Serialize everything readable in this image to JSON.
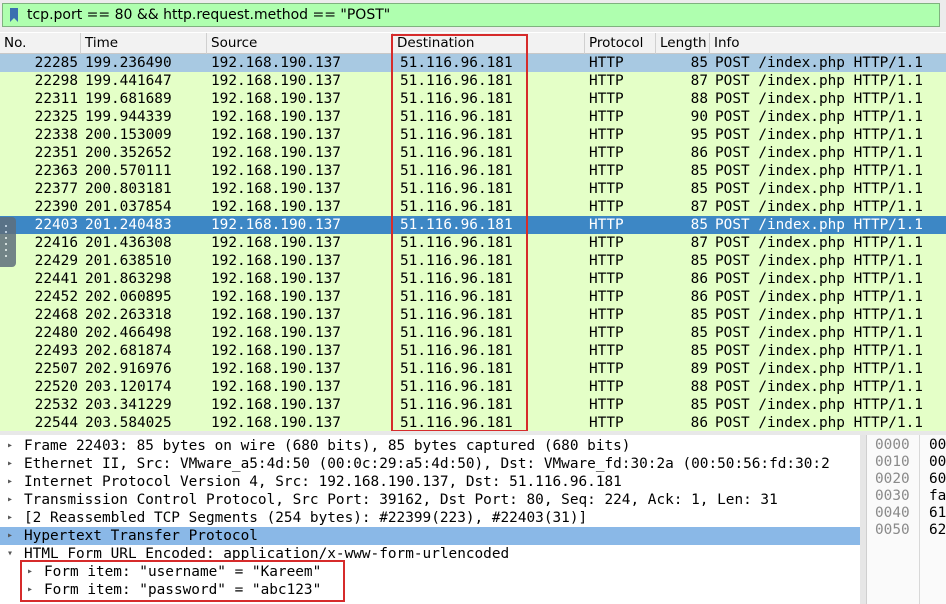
{
  "filter": {
    "text": "tcp.port == 80 && http.request.method == \"POST\""
  },
  "columns": [
    "No.",
    "Time",
    "Source",
    "Destination",
    "Protocol",
    "Length",
    "Info"
  ],
  "packets": [
    {
      "no": "22285",
      "time": "199.236490",
      "src": "192.168.190.137",
      "dst": "51.116.96.181",
      "proto": "HTTP",
      "len": "85",
      "info": "POST /index.php HTTP/1.1"
    },
    {
      "no": "22298",
      "time": "199.441647",
      "src": "192.168.190.137",
      "dst": "51.116.96.181",
      "proto": "HTTP",
      "len": "87",
      "info": "POST /index.php HTTP/1.1"
    },
    {
      "no": "22311",
      "time": "199.681689",
      "src": "192.168.190.137",
      "dst": "51.116.96.181",
      "proto": "HTTP",
      "len": "88",
      "info": "POST /index.php HTTP/1.1"
    },
    {
      "no": "22325",
      "time": "199.944339",
      "src": "192.168.190.137",
      "dst": "51.116.96.181",
      "proto": "HTTP",
      "len": "90",
      "info": "POST /index.php HTTP/1.1"
    },
    {
      "no": "22338",
      "time": "200.153009",
      "src": "192.168.190.137",
      "dst": "51.116.96.181",
      "proto": "HTTP",
      "len": "95",
      "info": "POST /index.php HTTP/1.1"
    },
    {
      "no": "22351",
      "time": "200.352652",
      "src": "192.168.190.137",
      "dst": "51.116.96.181",
      "proto": "HTTP",
      "len": "86",
      "info": "POST /index.php HTTP/1.1"
    },
    {
      "no": "22363",
      "time": "200.570111",
      "src": "192.168.190.137",
      "dst": "51.116.96.181",
      "proto": "HTTP",
      "len": "85",
      "info": "POST /index.php HTTP/1.1"
    },
    {
      "no": "22377",
      "time": "200.803181",
      "src": "192.168.190.137",
      "dst": "51.116.96.181",
      "proto": "HTTP",
      "len": "85",
      "info": "POST /index.php HTTP/1.1"
    },
    {
      "no": "22390",
      "time": "201.037854",
      "src": "192.168.190.137",
      "dst": "51.116.96.181",
      "proto": "HTTP",
      "len": "87",
      "info": "POST /index.php HTTP/1.1"
    },
    {
      "no": "22403",
      "time": "201.240483",
      "src": "192.168.190.137",
      "dst": "51.116.96.181",
      "proto": "HTTP",
      "len": "85",
      "info": "POST /index.php HTTP/1.1"
    },
    {
      "no": "22416",
      "time": "201.436308",
      "src": "192.168.190.137",
      "dst": "51.116.96.181",
      "proto": "HTTP",
      "len": "87",
      "info": "POST /index.php HTTP/1.1"
    },
    {
      "no": "22429",
      "time": "201.638510",
      "src": "192.168.190.137",
      "dst": "51.116.96.181",
      "proto": "HTTP",
      "len": "85",
      "info": "POST /index.php HTTP/1.1"
    },
    {
      "no": "22441",
      "time": "201.863298",
      "src": "192.168.190.137",
      "dst": "51.116.96.181",
      "proto": "HTTP",
      "len": "86",
      "info": "POST /index.php HTTP/1.1"
    },
    {
      "no": "22452",
      "time": "202.060895",
      "src": "192.168.190.137",
      "dst": "51.116.96.181",
      "proto": "HTTP",
      "len": "86",
      "info": "POST /index.php HTTP/1.1"
    },
    {
      "no": "22468",
      "time": "202.263318",
      "src": "192.168.190.137",
      "dst": "51.116.96.181",
      "proto": "HTTP",
      "len": "85",
      "info": "POST /index.php HTTP/1.1"
    },
    {
      "no": "22480",
      "time": "202.466498",
      "src": "192.168.190.137",
      "dst": "51.116.96.181",
      "proto": "HTTP",
      "len": "85",
      "info": "POST /index.php HTTP/1.1"
    },
    {
      "no": "22493",
      "time": "202.681874",
      "src": "192.168.190.137",
      "dst": "51.116.96.181",
      "proto": "HTTP",
      "len": "85",
      "info": "POST /index.php HTTP/1.1"
    },
    {
      "no": "22507",
      "time": "202.916976",
      "src": "192.168.190.137",
      "dst": "51.116.96.181",
      "proto": "HTTP",
      "len": "89",
      "info": "POST /index.php HTTP/1.1"
    },
    {
      "no": "22520",
      "time": "203.120174",
      "src": "192.168.190.137",
      "dst": "51.116.96.181",
      "proto": "HTTP",
      "len": "88",
      "info": "POST /index.php HTTP/1.1"
    },
    {
      "no": "22532",
      "time": "203.341229",
      "src": "192.168.190.137",
      "dst": "51.116.96.181",
      "proto": "HTTP",
      "len": "85",
      "info": "POST /index.php HTTP/1.1"
    },
    {
      "no": "22544",
      "time": "203.584025",
      "src": "192.168.190.137",
      "dst": "51.116.96.181",
      "proto": "HTTP",
      "len": "86",
      "info": "POST /index.php HTTP/1.1"
    }
  ],
  "selected_packet": "22403",
  "details": [
    {
      "text": "Frame 22403: 85 bytes on wire (680 bits), 85 bytes captured (680 bits)",
      "arrow": "closed",
      "level": 0
    },
    {
      "text": "Ethernet II, Src: VMware_a5:4d:50 (00:0c:29:a5:4d:50), Dst: VMware_fd:30:2a (00:50:56:fd:30:2",
      "arrow": "closed",
      "level": 0
    },
    {
      "text": "Internet Protocol Version 4, Src: 192.168.190.137, Dst: 51.116.96.181",
      "arrow": "closed",
      "level": 0
    },
    {
      "text": "Transmission Control Protocol, Src Port: 39162, Dst Port: 80, Seq: 224, Ack: 1, Len: 31",
      "arrow": "closed",
      "level": 0
    },
    {
      "text": "[2 Reassembled TCP Segments (254 bytes): #22399(223), #22403(31)]",
      "arrow": "closed",
      "level": 0
    },
    {
      "text": "Hypertext Transfer Protocol",
      "arrow": "closed",
      "level": 0,
      "highlight": true
    },
    {
      "text": "HTML Form URL Encoded: application/x-www-form-urlencoded",
      "arrow": "open",
      "level": 0
    },
    {
      "text": "Form item: \"username\" = \"Kareem\"",
      "arrow": "closed",
      "level": 1
    },
    {
      "text": "Form item: \"password\" = \"abc123\"",
      "arrow": "closed",
      "level": 1
    }
  ],
  "hex": [
    {
      "offset": "0000",
      "bytes": "00"
    },
    {
      "offset": "0010",
      "bytes": "00"
    },
    {
      "offset": "0020",
      "bytes": "60"
    },
    {
      "offset": "0030",
      "bytes": "fa"
    },
    {
      "offset": "0040",
      "bytes": "61"
    },
    {
      "offset": "0050",
      "bytes": "62"
    }
  ],
  "colors": {
    "http_row": "#e4ffc7",
    "selected_row": "#3d87c5",
    "filter_ok": "#afffaf",
    "annotation_box": "#d62b2b"
  }
}
